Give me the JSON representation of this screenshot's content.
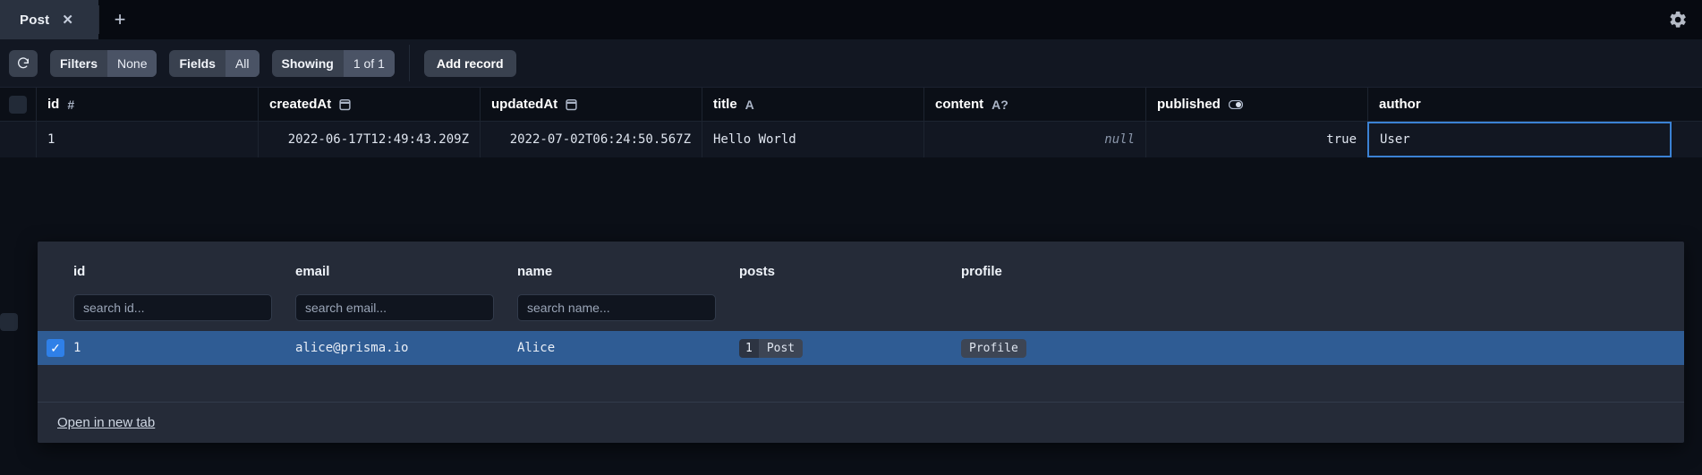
{
  "window": {
    "settings_icon": "gear-icon"
  },
  "tabs": {
    "items": [
      {
        "label": "Post",
        "close_label": "✕",
        "active": true
      }
    ],
    "add_label": "+"
  },
  "toolbar": {
    "refresh_icon": "refresh-icon",
    "filters": {
      "label": "Filters",
      "value": "None"
    },
    "fields": {
      "label": "Fields",
      "value": "All"
    },
    "showing": {
      "label": "Showing",
      "value": "1 of 1"
    },
    "add_record_label": "Add record"
  },
  "grid": {
    "columns": [
      {
        "name": "id",
        "type_icon": "#",
        "class": "c-id"
      },
      {
        "name": "createdAt",
        "type_icon": "⎕",
        "class": "c-created"
      },
      {
        "name": "updatedAt",
        "type_icon": "⎕",
        "class": "c-updated"
      },
      {
        "name": "title",
        "type_icon": "A",
        "class": "c-title"
      },
      {
        "name": "content",
        "type_icon": "A?",
        "class": "c-content"
      },
      {
        "name": "published",
        "type_icon": "toggle",
        "class": "c-published"
      },
      {
        "name": "author",
        "type_icon": "",
        "class": "c-author"
      }
    ],
    "rows": [
      {
        "id": "1",
        "createdAt": "2022-06-17T12:49:43.209Z",
        "updatedAt": "2022-07-02T06:24:50.567Z",
        "title": "Hello World",
        "content": "null",
        "published": "true",
        "author": "User"
      }
    ]
  },
  "popup": {
    "columns": [
      {
        "label": "id",
        "placeholder": "search id..."
      },
      {
        "label": "email",
        "placeholder": "search email..."
      },
      {
        "label": "name",
        "placeholder": "search name..."
      },
      {
        "label": "posts",
        "placeholder": ""
      },
      {
        "label": "profile",
        "placeholder": ""
      }
    ],
    "row": {
      "checked": true,
      "check_glyph": "✓",
      "id": "1",
      "email": "alice@prisma.io",
      "name": "Alice",
      "posts_count": "1",
      "posts_label": "Post",
      "profile_label": "Profile"
    },
    "footer_link": "Open in new tab"
  },
  "colors": {
    "accent": "#2f80e8",
    "selected_row": "#2f5c94",
    "selection_border": "#3b82d4",
    "panel_bg": "#252b38",
    "toolbar_bg": "#121722",
    "app_bg": "#0b0f17"
  }
}
